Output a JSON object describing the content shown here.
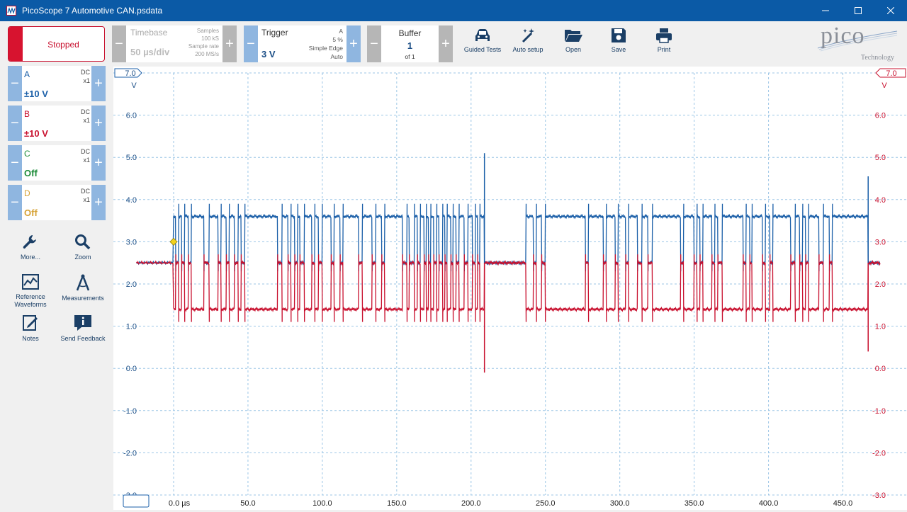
{
  "window": {
    "title": "PicoScope 7 Automotive CAN.psdata"
  },
  "run_button": {
    "label": "Stopped"
  },
  "timebase": {
    "label": "Timebase",
    "value": "50 µs/div",
    "samples_label": "Samples",
    "samples_value": "100 kS",
    "rate_label": "Sample rate",
    "rate_value": "200 MS/s"
  },
  "trigger": {
    "label": "Trigger",
    "value": "3 V",
    "channel": "A",
    "pretrigger": "5 %",
    "type": "Simple Edge",
    "mode": "Auto"
  },
  "buffer": {
    "label": "Buffer",
    "value": "1",
    "of": "of 1"
  },
  "toolbar": {
    "guided": "Guided Tests",
    "autosetup": "Auto setup",
    "open": "Open",
    "save": "Save",
    "print": "Print"
  },
  "logo": {
    "brand": "pico",
    "sub": "Technology"
  },
  "channels": [
    {
      "name": "A",
      "range": "±10 V",
      "coupling": "DC",
      "probe": "x1",
      "color": "#1b5fa8"
    },
    {
      "name": "B",
      "range": "±10 V",
      "coupling": "DC",
      "probe": "x1",
      "color": "#c8102e"
    },
    {
      "name": "C",
      "range": "Off",
      "coupling": "DC",
      "probe": "x1",
      "color": "#1e8c3a"
    },
    {
      "name": "D",
      "range": "Off",
      "coupling": "DC",
      "probe": "x1",
      "color": "#d6a235"
    }
  ],
  "side_tools": {
    "more": "More...",
    "zoom": "Zoom",
    "reference": "Reference Waveforms",
    "measurements": "Measurements",
    "notes": "Notes",
    "feedback": "Send Feedback"
  },
  "chart_data": {
    "type": "line",
    "y_ticks_left": [
      "7.0",
      "6.0",
      "5.0",
      "4.0",
      "3.0",
      "2.0",
      "1.0",
      "0.0",
      "-1.0",
      "-2.0",
      "-3.0"
    ],
    "y_ticks_right": [
      "7.0",
      "6.0",
      "5.0",
      "4.0",
      "3.0",
      "2.0",
      "1.0",
      "0.0",
      "-1.0",
      "-2.0",
      "-3.0"
    ],
    "y_unit_left": "V",
    "y_unit_right": "V",
    "x_ticks": [
      "0.0 µs",
      "50.0",
      "100.0",
      "150.0",
      "200.0",
      "250.0",
      "300.0",
      "350.0",
      "400.0",
      "450.0"
    ],
    "ylim": [
      -3,
      7
    ],
    "xlim": [
      0,
      475
    ],
    "trigger_level": 3.0,
    "series": [
      {
        "name": "A",
        "color": "#1b5fa8",
        "recessive": 2.5,
        "dominant": 3.6
      },
      {
        "name": "B",
        "color": "#c8102e",
        "recessive": 2.5,
        "dominant": 1.4
      }
    ],
    "dominant_intervals": [
      [
        0,
        1.5
      ],
      [
        3.5,
        5.5
      ],
      [
        7.5,
        10
      ],
      [
        12,
        20.5
      ],
      [
        24,
        30
      ],
      [
        32,
        35.5
      ],
      [
        37.5,
        41
      ],
      [
        43.5,
        45.5
      ],
      [
        48,
        70
      ],
      [
        73,
        77
      ],
      [
        79,
        81.5
      ],
      [
        83.5,
        85
      ],
      [
        88,
        93
      ],
      [
        95,
        97.5
      ],
      [
        100,
        106
      ],
      [
        108,
        112
      ],
      [
        114,
        124.5
      ],
      [
        127,
        133.5
      ],
      [
        136,
        140
      ],
      [
        142,
        154
      ],
      [
        157,
        158.5
      ],
      [
        162,
        164
      ],
      [
        166,
        168.5
      ],
      [
        170,
        171.5
      ],
      [
        173,
        175
      ],
      [
        177,
        178.5
      ],
      [
        181,
        182.5
      ],
      [
        184,
        186.5
      ],
      [
        188,
        190
      ],
      [
        192,
        195.5
      ],
      [
        198,
        201
      ],
      [
        203,
        204.5
      ],
      [
        206,
        209
      ],
      [
        237,
        242
      ],
      [
        244,
        247.5
      ],
      [
        250,
        277
      ],
      [
        279,
        289
      ],
      [
        291,
        297
      ],
      [
        299,
        304
      ],
      [
        306,
        312
      ],
      [
        315,
        319
      ],
      [
        322,
        341
      ],
      [
        343,
        350
      ],
      [
        352,
        354
      ],
      [
        356,
        362
      ],
      [
        364,
        366
      ],
      [
        369,
        383
      ],
      [
        385,
        387.5
      ],
      [
        389,
        396
      ],
      [
        398,
        401
      ],
      [
        403,
        415
      ],
      [
        418,
        421
      ],
      [
        423,
        425
      ],
      [
        427,
        434
      ],
      [
        437,
        441
      ],
      [
        443,
        467
      ]
    ]
  }
}
